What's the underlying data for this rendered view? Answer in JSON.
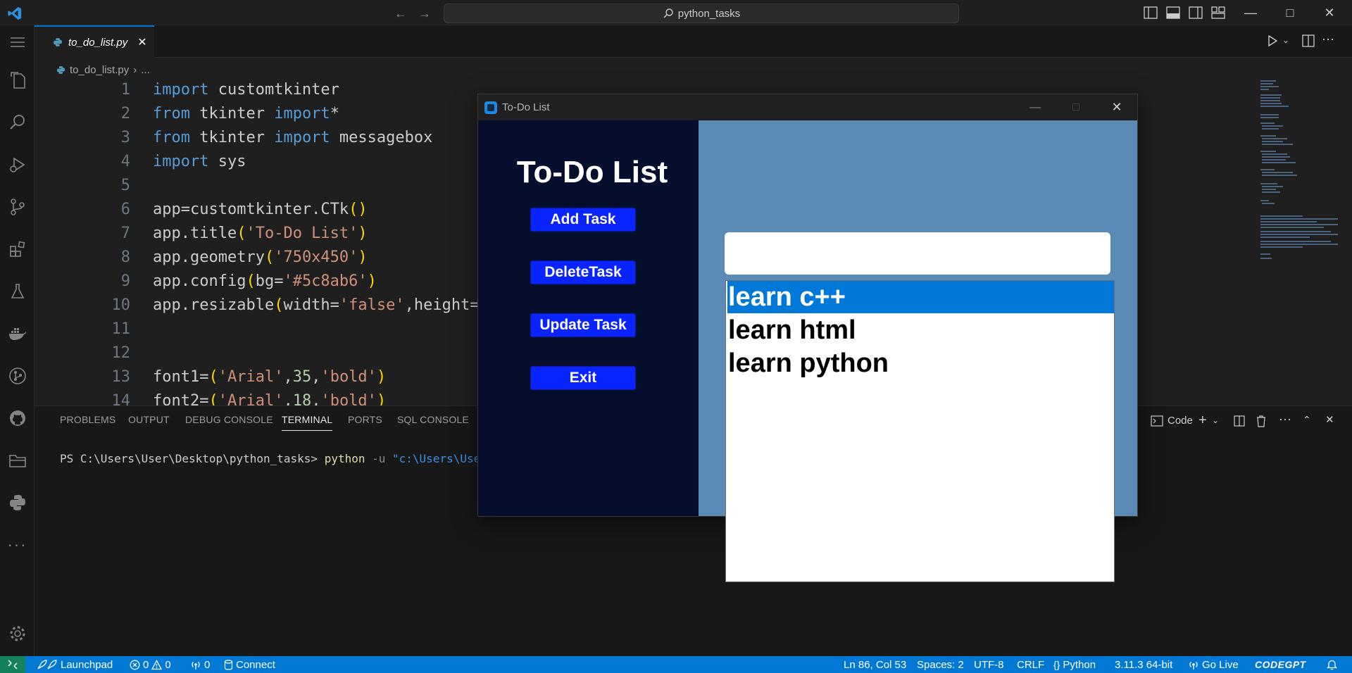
{
  "titlebar": {
    "search_text": "python_tasks"
  },
  "editor": {
    "tab_label": "to_do_list.py",
    "breadcrumb_file": "to_do_list.py",
    "breadcrumb_more": "...",
    "line_numbers": [
      "1",
      "2",
      "3",
      "4",
      "5",
      "6",
      "7",
      "8",
      "9",
      "10",
      "11",
      "12",
      "13",
      "14"
    ]
  },
  "panel": {
    "tabs": [
      "PROBLEMS",
      "OUTPUT",
      "DEBUG CONSOLE",
      "TERMINAL",
      "PORTS",
      "SQL CONSOLE"
    ],
    "terminal_profile": "Code",
    "prompt": "PS C:\\Users\\User\\Desktop\\python_tasks> ",
    "cmd": "python",
    "flag": " -u ",
    "arg": "\"c:\\Users\\User\\De"
  },
  "statusbar": {
    "launchpad": "Launchpad",
    "errors": "0",
    "warnings": "0",
    "ports": "0",
    "connect": "Connect",
    "position": "Ln 86, Col 53",
    "spaces": "Spaces: 2",
    "encoding": "UTF-8",
    "eol": "CRLF",
    "language": "Python",
    "interpreter": "3.11.3 64-bit",
    "golive": "Go Live",
    "codegpt": "CODEGPT"
  },
  "app": {
    "window_title": "To-Do List",
    "heading": "To-Do List",
    "buttons": {
      "add": "Add Task",
      "delete": "DeleteTask",
      "update": "Update Task",
      "exit": "Exit"
    },
    "entry_value": "",
    "tasks": [
      "learn c++",
      "learn html",
      "learn python"
    ],
    "selected_index": 0,
    "colors": {
      "left_bg": "#050f2d",
      "right_bg": "#5c8ab6",
      "button_bg": "#0a24ff",
      "selection": "#0078d7"
    }
  },
  "colors": {
    "accent": "#0078d4",
    "remote": "#16825d"
  }
}
